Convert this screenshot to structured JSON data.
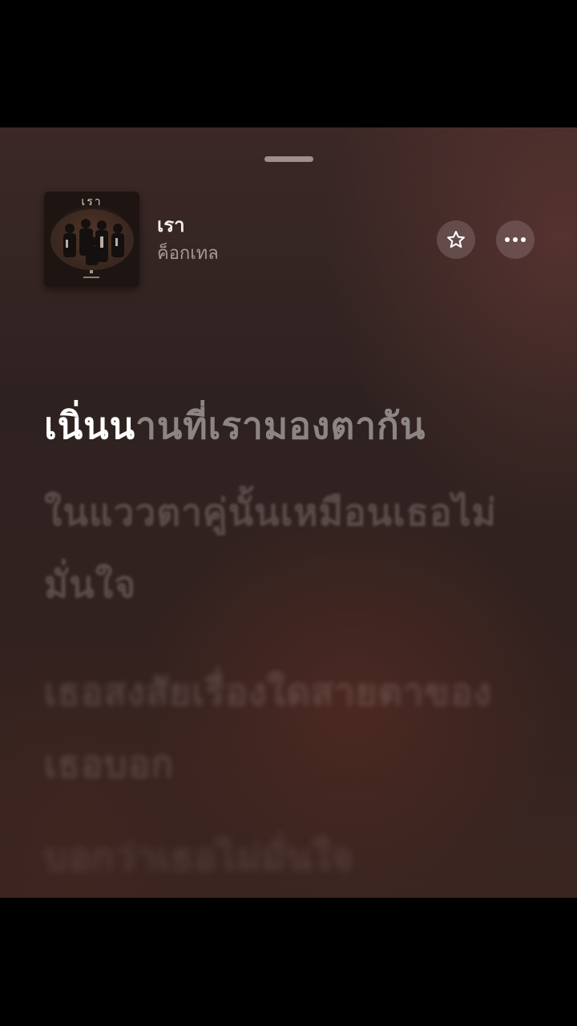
{
  "track": {
    "title": "เรา",
    "artist": "ค็อกเทล",
    "cover_text": "เรา"
  },
  "actions": {
    "favorite_icon": "star-icon",
    "more_icon": "ellipsis-icon"
  },
  "lyrics": {
    "current_sung": "เนิ่นน",
    "current_rest": "านที่เรามองตากัน",
    "next": [
      "ในแววตาคู่นั้นเหมือนเธอไม่มั่นใจ",
      "เธอสงสัยเรื่องใดสายตาของเธอบอก",
      "บอกว่าเธอไม่มั่นใจ"
    ]
  },
  "colors": {
    "background": "#2e2220",
    "lyric_active": "#ffffff",
    "lyric_dim": "#8a7e7c"
  }
}
